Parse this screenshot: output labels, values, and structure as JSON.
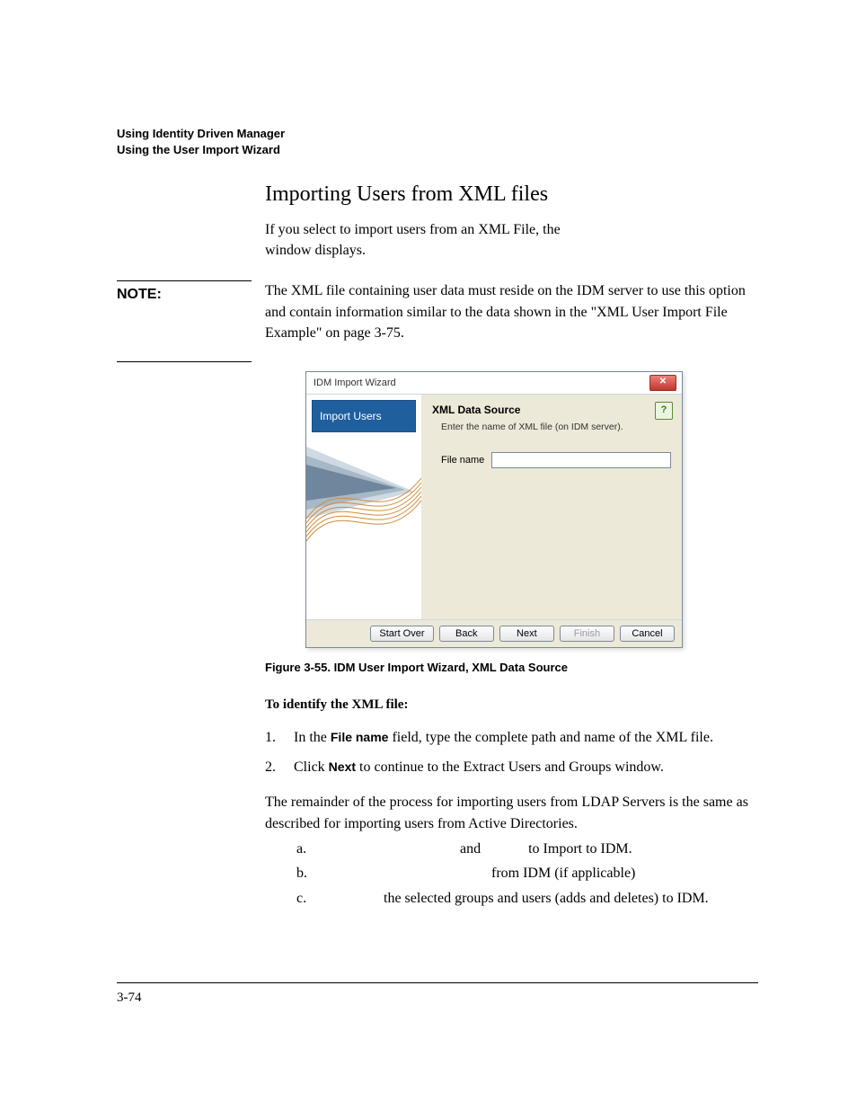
{
  "header": {
    "line1": "Using Identity Driven Manager",
    "line2": "Using the User Import Wizard"
  },
  "section_title": "Importing Users from XML files",
  "intro": {
    "part1": "If you select to import users from an XML File, the",
    "part2": "window displays."
  },
  "note": {
    "label": "NOTE:",
    "body": "The XML file containing user data must reside on the IDM server to use this option and contain information similar to the data shown in the \"XML User Import File Example\" on page 3-75."
  },
  "wizard": {
    "title": "IDM Import Wizard",
    "close_glyph": "✕",
    "step_label": "Import Users",
    "heading": "XML Data Source",
    "subheading": "Enter the name of XML file (on IDM server).",
    "help_glyph": "?",
    "file_label": "File name",
    "file_value": "",
    "buttons": {
      "start_over": "Start Over",
      "back": "Back",
      "next": "Next",
      "finish": "Finish",
      "cancel": "Cancel"
    }
  },
  "figure_caption": "Figure 3-55. IDM User Import Wizard, XML Data Source",
  "identify_heading": "To identify the XML file:",
  "steps": {
    "s1_num": "1.",
    "s1_a": "In the ",
    "s1_b": "File name",
    "s1_c": " field, type the complete path and name of the XML file.",
    "s2_num": "2.",
    "s2_a": "Click ",
    "s2_b": "Next",
    "s2_c": " to continue to the Extract Users and Groups window."
  },
  "remainder": "The remainder of the process for importing users from LDAP Servers is the same as described for importing users from Active Directories.",
  "sublist": {
    "a_letter": "a.",
    "a_mid1": "and",
    "a_tail": "to Import to IDM.",
    "b_letter": "b.",
    "b_tail": "from IDM (if applicable)",
    "c_letter": "c.",
    "c_tail": "the selected groups and users (adds and deletes) to IDM."
  },
  "page_number": "3-74"
}
